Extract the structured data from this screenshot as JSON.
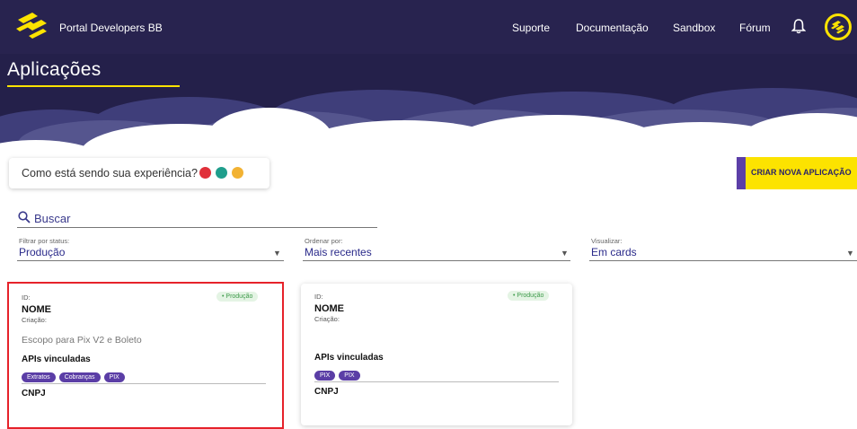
{
  "header": {
    "brand": "Portal Developers BB",
    "nav": [
      "Suporte",
      "Documentação",
      "Sandbox",
      "Fórum"
    ],
    "page_title": "Aplicações"
  },
  "feedback": {
    "question": "Como está sendo sua experiência?",
    "emoji_colors": [
      "#e0303a",
      "#1f9e8c",
      "#f2b233"
    ]
  },
  "cta": {
    "label": "CRIAR NOVA APLICAÇÃO"
  },
  "search": {
    "placeholder": "Buscar"
  },
  "filters": {
    "status": {
      "label": "Filtrar por status:",
      "value": "Produção"
    },
    "order": {
      "label": "Ordenar por:",
      "value": "Mais recentes"
    },
    "view": {
      "label": "Visualizar:",
      "value": "Em cards"
    }
  },
  "cards": [
    {
      "id_label": "ID:",
      "status": "• Produção",
      "name": "NOME",
      "created_label": "Criação:",
      "scope": "Escopo para Pix V2 e Boleto",
      "apis_title": "APIs vinculadas",
      "apis": [
        "Extratos",
        "Cobranças",
        "PIX"
      ],
      "cnpj_label": "CNPJ"
    },
    {
      "id_label": "ID:",
      "status": "• Produção",
      "name": "NOME",
      "created_label": "Criação:",
      "scope": "",
      "apis_title": "APIs vinculadas",
      "apis": [
        "PIX",
        "PIX"
      ],
      "cnpj_label": "CNPJ"
    }
  ],
  "colors": {
    "hero": "#24204a",
    "accent": "#fce300",
    "purple": "#5b3ea6",
    "selection": "#e6222a"
  }
}
